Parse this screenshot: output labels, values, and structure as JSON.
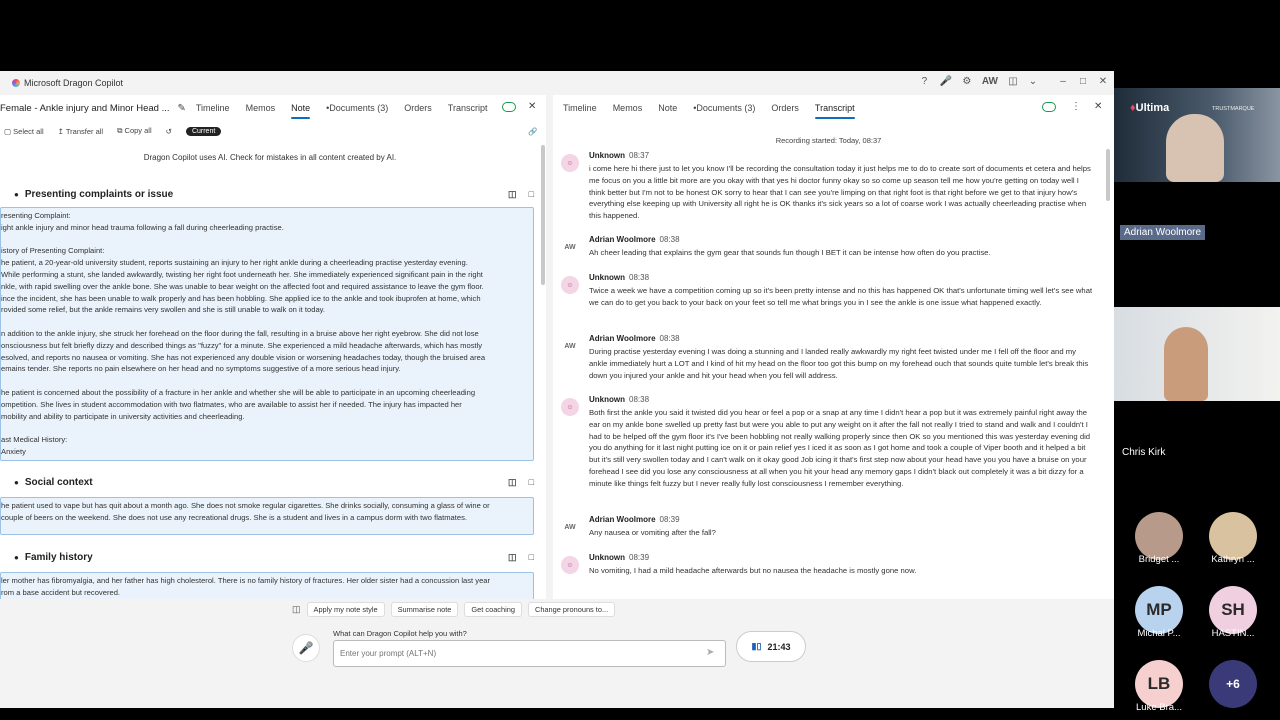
{
  "app": {
    "title": "Microsoft Dragon Copilot",
    "user_initials": "AW"
  },
  "left": {
    "note_title": "Female - Ankle injury and Minor Head ...",
    "tabs": [
      "Timeline",
      "Memos",
      "Note",
      "•Documents (3)",
      "Orders",
      "Transcript"
    ],
    "active_tab": "Note",
    "toolbar": {
      "select_all": "Select all",
      "transfer_all": "Transfer all",
      "copy_all": "Copy all",
      "current": "Current"
    },
    "disclaimer": "Dragon Copilot uses AI. Check for mistakes in all content created by AI.",
    "sections": [
      {
        "title": "Presenting complaints or issue",
        "paragraphs": [
          "resenting Complaint:\night ankle injury and minor head trauma following a fall during cheerleading practise.",
          "istory of Presenting Complaint:\nhe patient, a 20-year-old university student, reports sustaining an injury to her right ankle during a cheerleading practise yesterday evening.\nWhile performing a stunt, she landed awkwardly, twisting her right foot underneath her. She immediately experienced significant pain in the right\nnkle, with rapid swelling over the ankle bone. She was unable to bear weight on the affected foot and required assistance to leave the gym floor.\nince the incident, she has been unable to walk properly and has been hobbling. She applied ice to the ankle and took ibuprofen at home, which\nrovided some relief, but the ankle remains very swollen and she is still unable to walk on it today.",
          "n addition to the ankle injury, she struck her forehead on the floor during the fall, resulting in a bruise above her right eyebrow. She did not lose\nonsciousness but felt briefly dizzy and described things as \"fuzzy\" for a minute. She experienced a mild headache afterwards, which has mostly\nesolved, and reports no nausea or vomiting. She has not experienced any double vision or worsening headaches today, though the bruised area\nemains tender. She reports no pain elsewhere on her head and no symptoms suggestive of a more serious head injury.",
          "he patient is concerned about the possibility of a fracture in her ankle and whether she will be able to participate in an upcoming cheerleading\nompetition. She lives in student accommodation with two flatmates, who are available to assist her if needed. The injury has impacted her\nmobility and ability to participate in university activities and cheerleading.",
          "ast Medical History:\n Anxiety"
        ]
      },
      {
        "title": "Social context",
        "paragraphs": [
          "he patient used to vape but has quit about a month ago. She does not smoke regular cigarettes. She drinks socially, consuming a glass of wine or\n couple of beers on the weekend. She does not use any recreational drugs. She is a student and lives in a campus dorm with two flatmates."
        ]
      },
      {
        "title": "Family history",
        "paragraphs": [
          "ler mother has fibromyalgia, and her father has high cholesterol. There is no family history of fractures. Her older sister had a concussion last year\nrom a base accident but recovered."
        ]
      }
    ]
  },
  "right": {
    "tabs": [
      "Timeline",
      "Memos",
      "Note",
      "•Documents (3)",
      "Orders",
      "Transcript"
    ],
    "active_tab": "Transcript",
    "recording": "Recording started: Today, 08:37",
    "entries": [
      {
        "initials": "",
        "speaker": "Unknown",
        "time": "08:37",
        "text": "i come here hi there just to let you know I'll be recording the consultation today it just helps me to do to create sort of documents et cetera and helps me focus on you a little bit more are you okay with that yes hi doctor funny okay so so come up season tell me how you're getting on today well I think better but I'm not to be honest OK sorry to hear that I can see you're limping on that right foot is that right before we get to that injury how's everything else keeping up with University all right he is OK thanks it's sick years so a lot of coarse work I was actually cheerleading practise when this happened."
      },
      {
        "initials": "AW",
        "speaker": "Adrian Woolmore",
        "time": "08:38",
        "text": "Ah cheer leading that explains the gym gear that sounds fun though I BET it can be intense how often do you practise."
      },
      {
        "initials": "",
        "speaker": "Unknown",
        "time": "08:38",
        "text": "Twice a week we have a competition coming up so it's been pretty intense and no this has happened OK that's unfortunate timing well let's see what we can do to get you back to your back on your feet so tell me what brings you in I see the ankle is one issue what happened exactly."
      },
      {
        "initials": "AW",
        "speaker": "Adrian Woolmore",
        "time": "08:38",
        "text": "During practise yesterday evening I was doing a stunning and I landed really awkwardly my right feet twisted under me I fell off the floor and my ankle immediately hurt a LOT and I kind of hit my head on the floor too got this bump on my forehead ouch that sounds quite tumble let's break this down you injured your ankle and hit your head when you fell will address."
      },
      {
        "initials": "",
        "speaker": "Unknown",
        "time": "08:38",
        "text": "Both first the ankle you said it twisted did you hear or feel a pop or a snap at any time I didn't hear a pop but it was extremely painful right away the ear on my ankle bone swelled up pretty fast but were you able to put any weight on it after the fall not really I tried to stand and walk and I couldn't I had to be helped off the gym floor it's I've been hobbling not really walking properly since then OK so you mentioned this was yesterday evening did you do anything for it last night putting ice on it or pain relief yes I iced it as soon as I got home and took a couple of Viper booth and it helped a bit but it's still very swollen today and I can't walk on it okay good Job icing it that's first step now about your head have you you have a bruise on your forehead I see did you lose any consciousness at all when you hit your head any memory gaps I didn't black out completely it was a bit dizzy for a minute like things felt fuzzy but I never really fully lost consciousness I remember everything."
      },
      {
        "initials": "AW",
        "speaker": "Adrian Woolmore",
        "time": "08:39",
        "text": "Any nausea or vomiting after the fall?"
      },
      {
        "initials": "",
        "speaker": "Unknown",
        "time": "08:39",
        "text": "No vomiting, I had a mild headache afterwards but no nausea the headache is mostly gone now."
      }
    ]
  },
  "bottom": {
    "chips": [
      "Apply my note style",
      "Summarise note",
      "Get coaching",
      "Change pronouns to..."
    ],
    "prompt_label": "What can Dragon Copilot help you with?",
    "prompt_placeholder": "Enter your prompt (ALT+N)",
    "timer": "21:43"
  },
  "meeting": {
    "logo_text": "Ultima",
    "logo2_text": "TRUSTMARQUE",
    "speaker1": "Adrian Woolmore",
    "speaker2": "Chris Kirk",
    "participants": [
      {
        "initials": "",
        "name": "Bridget ...",
        "color": "#b89a8a"
      },
      {
        "initials": "",
        "name": "Kathryn ...",
        "color": "#d9c2a0"
      },
      {
        "initials": "MP",
        "name": "Michal P...",
        "color": "#b9d3ee"
      },
      {
        "initials": "SH",
        "name": "HASTIN...",
        "color": "#f0cfe0"
      },
      {
        "initials": "LB",
        "name": "Luke Bra...",
        "color": "#f6d0cf"
      },
      {
        "initials": "+6",
        "name": "",
        "color": "#3b3a78"
      }
    ]
  }
}
